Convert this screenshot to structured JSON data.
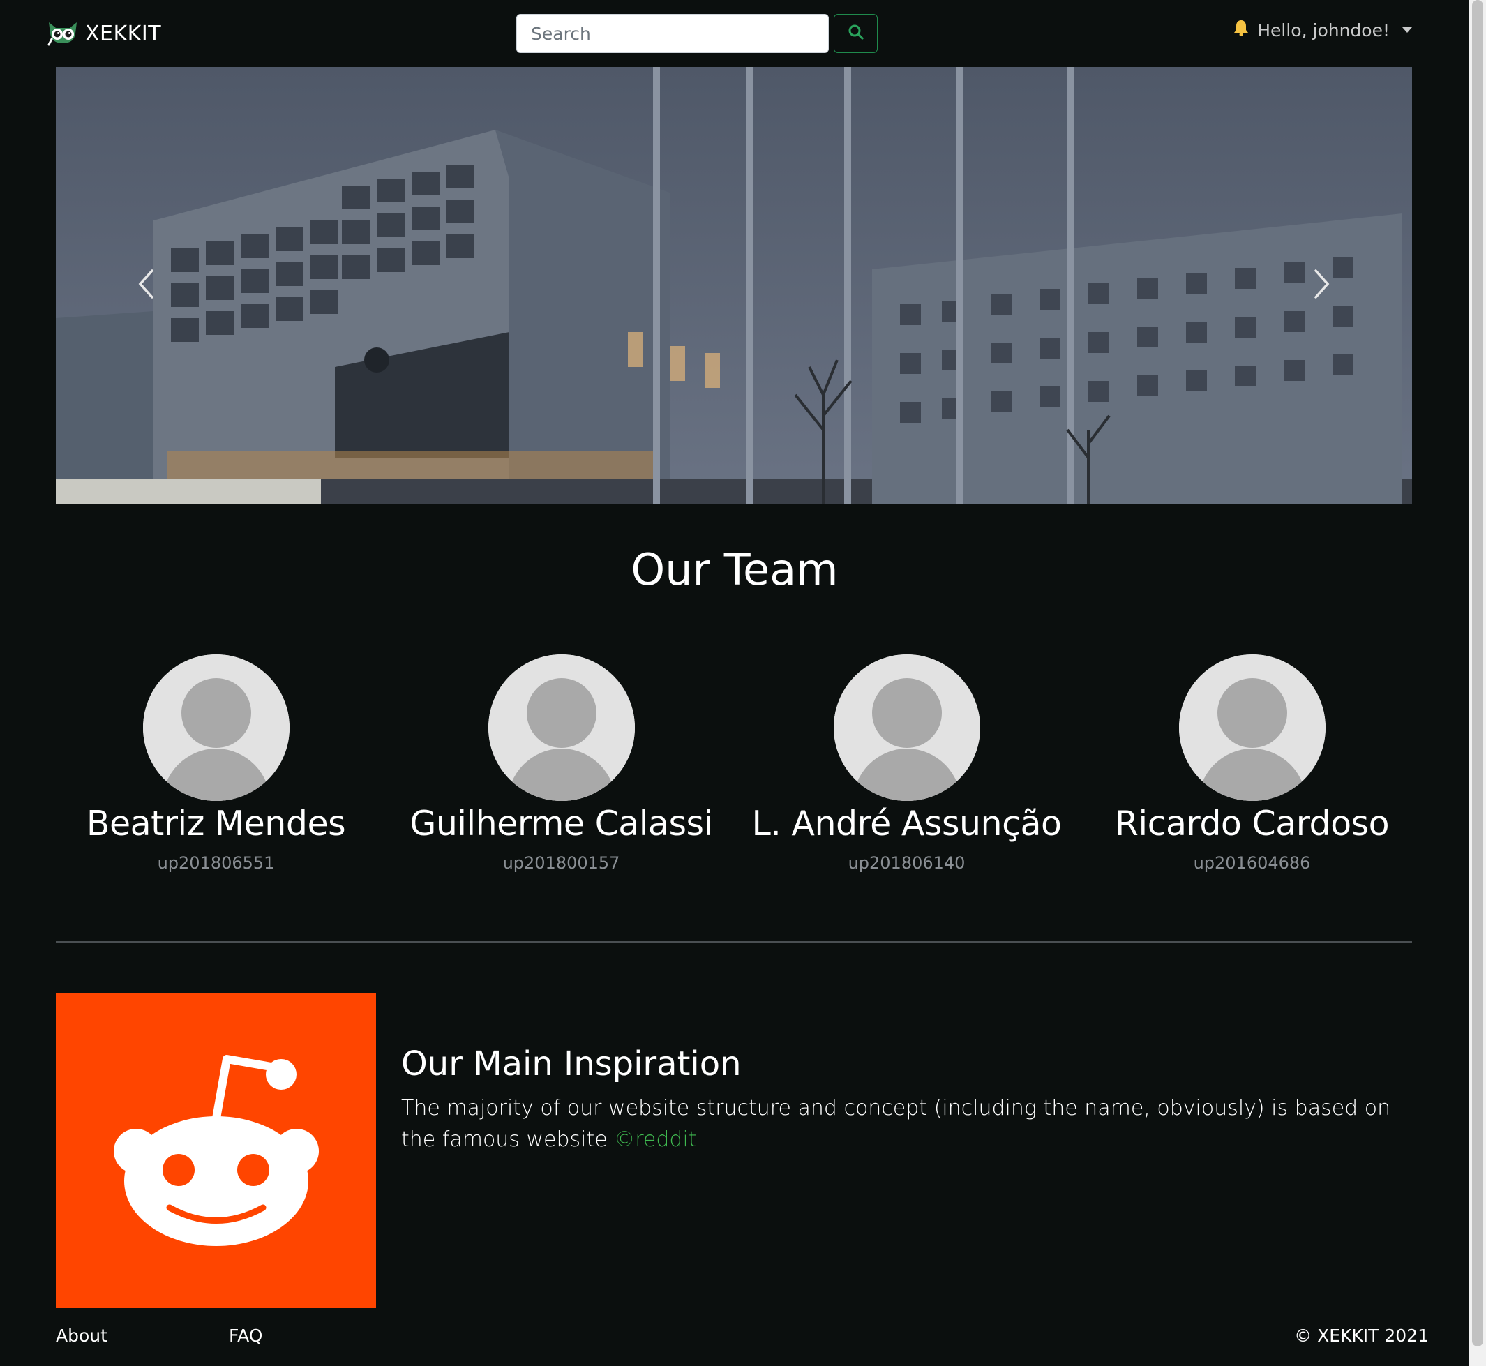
{
  "navbar": {
    "brand": "XEKKIT",
    "search_placeholder": "Search",
    "greeting": "Hello, johndoe!"
  },
  "team": {
    "title": "Our Team",
    "members": [
      {
        "name": "Beatriz Mendes",
        "id": "up201806551"
      },
      {
        "name": "Guilherme Calassi",
        "id": "up201800157"
      },
      {
        "name": "L. André Assunção",
        "id": "up201806140"
      },
      {
        "name": "Ricardo Cardoso",
        "id": "up201604686"
      }
    ]
  },
  "inspiration": {
    "title": "Our Main Inspiration",
    "text": "The majority of our website structure and concept (including the name, obviously) is based on the famous website",
    "link_text": "©reddit"
  },
  "footer": {
    "about": "About",
    "faq": "FAQ",
    "copyright": "© XEKKIT 2021"
  },
  "colors": {
    "background": "#0b0f0e",
    "accent_green": "#3fb950",
    "reddit_orange": "#ff4500",
    "bell": "#f5c242"
  },
  "icons": {
    "brand": "owl-logo-icon",
    "search": "search-icon",
    "notification": "bell-icon",
    "carousel_prev": "chevron-left-icon",
    "carousel_next": "chevron-right-icon",
    "avatar": "user-avatar-icon",
    "inspiration": "reddit-logo-icon"
  }
}
